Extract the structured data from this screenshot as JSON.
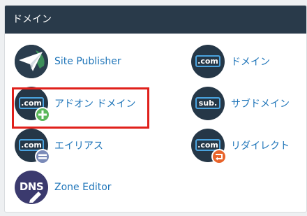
{
  "panel": {
    "title": "ドメイン"
  },
  "items": {
    "site_publisher": {
      "label": "Site Publisher"
    },
    "domains": {
      "label": "ドメイン",
      "tag": ".com"
    },
    "addon_domains": {
      "label": "アドオン ドメイン",
      "tag": ".com"
    },
    "subdomains": {
      "label": "サブドメイン",
      "tag": "sub."
    },
    "aliases": {
      "label": "エイリアス",
      "tag": ".com"
    },
    "redirects": {
      "label": "リダイレクト",
      "tag": ".com"
    },
    "zone_editor": {
      "label": "Zone Editor",
      "tag": "DNS"
    }
  },
  "colors": {
    "header_bg": "#293a4a",
    "link": "#1f75b9",
    "icon_bg": "#253747",
    "icon_border": "#4aa3df",
    "add_badge": "#5cb85c",
    "alias_badge": "#7a8ab8",
    "redirect_badge": "#e8632a",
    "highlight": "#e0201b"
  }
}
